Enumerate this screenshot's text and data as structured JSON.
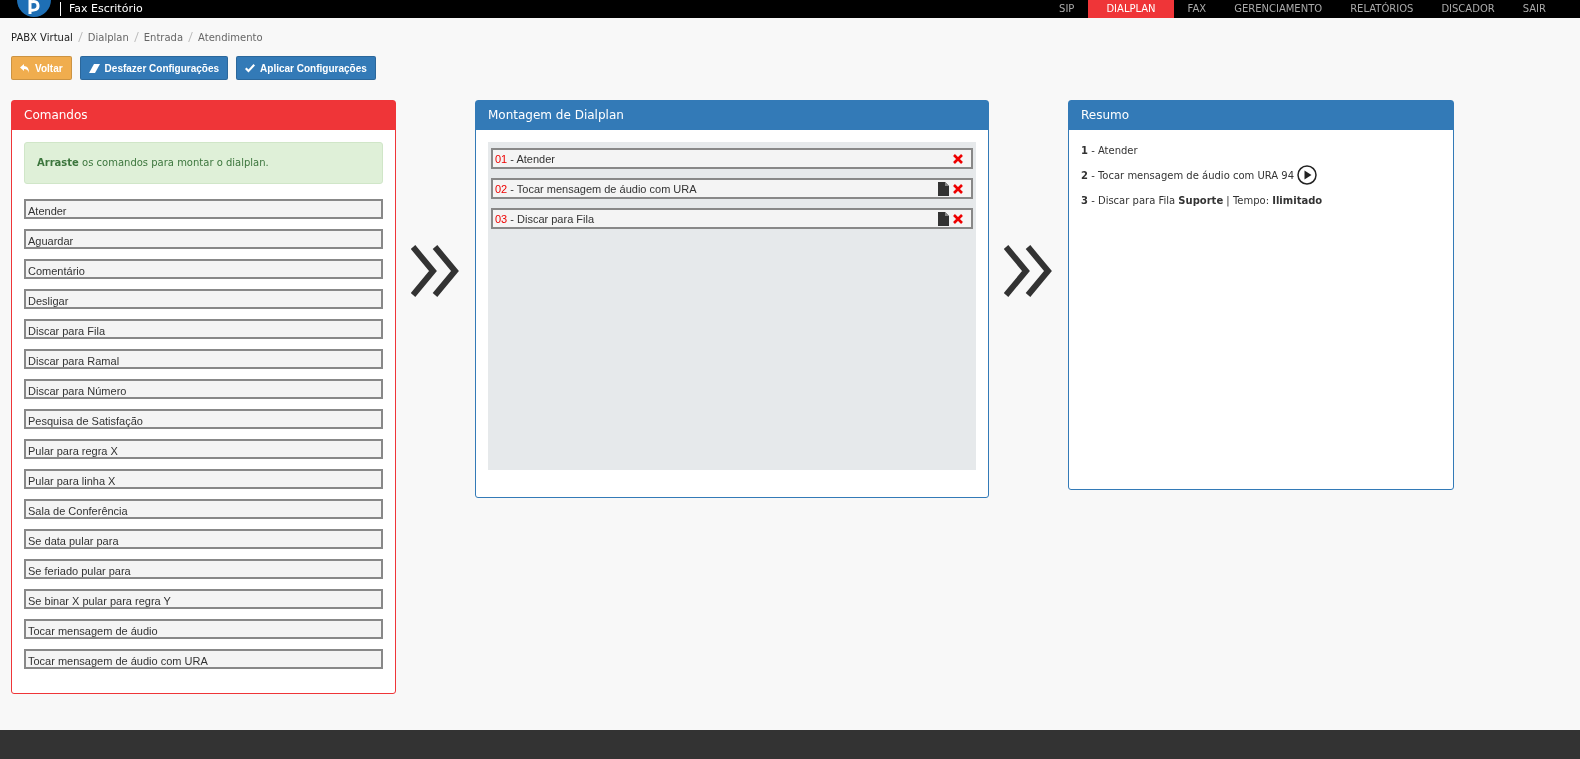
{
  "topbar": {
    "brand": "Fax Escritório",
    "nav": [
      {
        "label": "SIP",
        "selected": false
      },
      {
        "label": "DIALPLAN",
        "selected": true
      },
      {
        "label": "FAX",
        "selected": false
      },
      {
        "label": "GERENCIAMENTO",
        "selected": false
      },
      {
        "label": "RELATÓRIOS",
        "selected": false
      },
      {
        "label": "DISCADOR",
        "selected": false
      },
      {
        "label": "SAIR",
        "selected": false
      }
    ]
  },
  "breadcrumb": [
    "PABX Virtual",
    "Dialplan",
    "Entrada",
    "Atendimento"
  ],
  "buttons": [
    {
      "kind": "back",
      "label": "Voltar"
    },
    {
      "kind": "undo",
      "label": "Desfazer Configurações"
    },
    {
      "kind": "apply",
      "label": "Aplicar Configurações"
    }
  ],
  "commands": {
    "title": "Comandos",
    "hint": "**Arraste** os comandos para montar o dialplan.",
    "items": [
      "Atender",
      "Aguardar",
      "Comentário",
      "Desligar",
      "Discar para Fila",
      "Discar para Ramal",
      "Discar para Número",
      "Pesquisa de Satisfação",
      "Pular para regra X",
      "Pular para linha X",
      "Sala de Conferência",
      "Se data pular para",
      "Se feriado pular para",
      "Se binar X pular para regra Y",
      "Tocar mensagem de áudio",
      "Tocar mensagem de áudio com URA"
    ]
  },
  "dialplan": {
    "title": "Montagem de Dialplan",
    "steps": [
      {
        "number": "01",
        "label": "- Atender",
        "has_file": false
      },
      {
        "number": "02",
        "label": "- Tocar mensagem de áudio com URA",
        "has_file": true
      },
      {
        "number": "03",
        "label": "- Discar para Fila",
        "has_file": true
      }
    ]
  },
  "summary": {
    "title": "Resumo",
    "lines": [
      {
        "text": "**1** - Atender",
        "playable": false
      },
      {
        "text": "**2** - Tocar mensagem de áudio com URA 94",
        "playable": true
      },
      {
        "text": "**3** - Discar para Fila **Suporte** | Tempo: **Ilimitado**",
        "playable": false
      }
    ]
  }
}
